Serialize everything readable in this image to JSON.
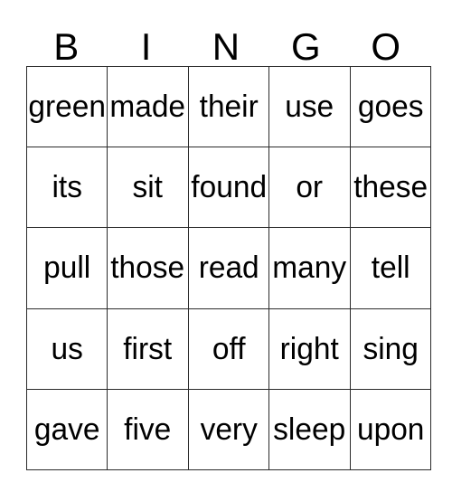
{
  "card": {
    "title": "BINGO",
    "header_letters": [
      "B",
      "I",
      "N",
      "G",
      "O"
    ],
    "grid_size": "5x5",
    "border_color": "#2b2b2b",
    "background_color": "#ffffff",
    "text_color": "#000000",
    "rows": [
      [
        "green",
        "made",
        "their",
        "use",
        "goes"
      ],
      [
        "its",
        "sit",
        "found",
        "or",
        "these"
      ],
      [
        "pull",
        "those",
        "read",
        "many",
        "tell"
      ],
      [
        "us",
        "first",
        "off",
        "right",
        "sing"
      ],
      [
        "gave",
        "five",
        "very",
        "sleep",
        "upon"
      ]
    ]
  }
}
